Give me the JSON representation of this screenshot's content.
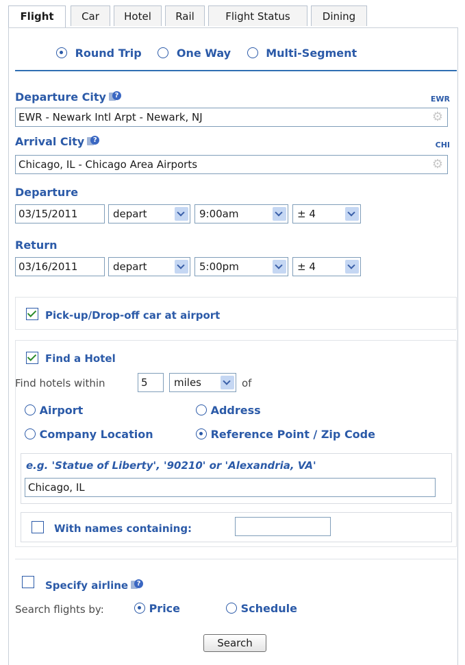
{
  "tabs": [
    "Flight",
    "Car",
    "Hotel",
    "Rail",
    "Flight Status",
    "Dining"
  ],
  "trip_type": {
    "options": [
      "Round Trip",
      "One Way",
      "Multi-Segment"
    ],
    "selected": "Round Trip"
  },
  "departure_city": {
    "label": "Departure City",
    "code": "EWR",
    "value": "EWR - Newark Intl Arpt - Newark, NJ"
  },
  "arrival_city": {
    "label": "Arrival City",
    "code": "CHI",
    "value": "Chicago, IL - Chicago Area Airports"
  },
  "departure": {
    "label": "Departure",
    "date": "03/15/2011",
    "mode": "depart",
    "time": "9:00am",
    "window": "± 4"
  },
  "return": {
    "label": "Return",
    "date": "03/16/2011",
    "mode": "depart",
    "time": "5:00pm",
    "window": "± 4"
  },
  "car": {
    "label": "Pick-up/Drop-off car at airport",
    "checked": true
  },
  "hotel": {
    "label": "Find a Hotel",
    "checked": true,
    "within_prefix": "Find hotels within",
    "distance": "5",
    "unit": "miles",
    "within_suffix": "of",
    "locations": [
      "Airport",
      "Address",
      "Company Location",
      "Reference Point / Zip Code"
    ],
    "selected_location": "Reference Point / Zip Code",
    "ref_hint": "e.g. 'Statue of Liberty', '90210' or 'Alexandria, VA'",
    "ref_value": "Chicago, IL",
    "names_label": "With names containing:",
    "names_value": ""
  },
  "airline": {
    "label": "Specify airline",
    "checked": false
  },
  "search_by": {
    "label": "Search flights by:",
    "options": [
      "Price",
      "Schedule"
    ],
    "selected": "Price"
  },
  "search_button": "Search",
  "colors": {
    "accent": "#2b5aa8",
    "check": "#2a8a2a",
    "divider": "#2f6fb3"
  }
}
